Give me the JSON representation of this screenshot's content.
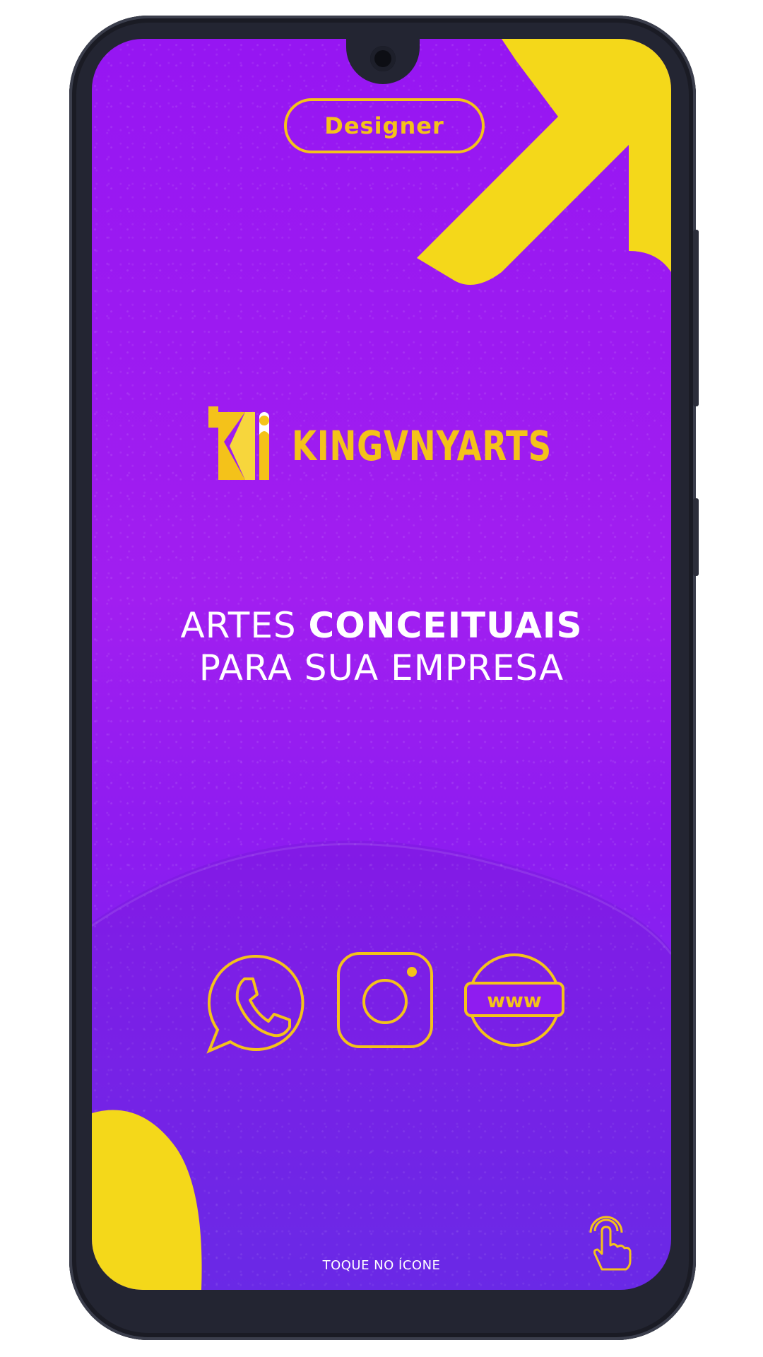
{
  "badge": {
    "label": "Designer"
  },
  "brand": {
    "name": "KINGVNYARTS"
  },
  "tagline": {
    "line1_regular": "ARTES ",
    "line1_bold": "CONCEITUAIS",
    "line2": "PARA SUA EMPRESA"
  },
  "actions": [
    {
      "icon": "whatsapp-icon"
    },
    {
      "icon": "instagram-icon"
    },
    {
      "icon": "website-icon",
      "text": "www"
    }
  ],
  "footer": {
    "hint": "TOQUE NO ÍCONE"
  },
  "colors": {
    "accent": "#f4c21a",
    "background_top": "#9616f2",
    "background_bottom": "#6e2ef0",
    "text": "#ffffff"
  }
}
